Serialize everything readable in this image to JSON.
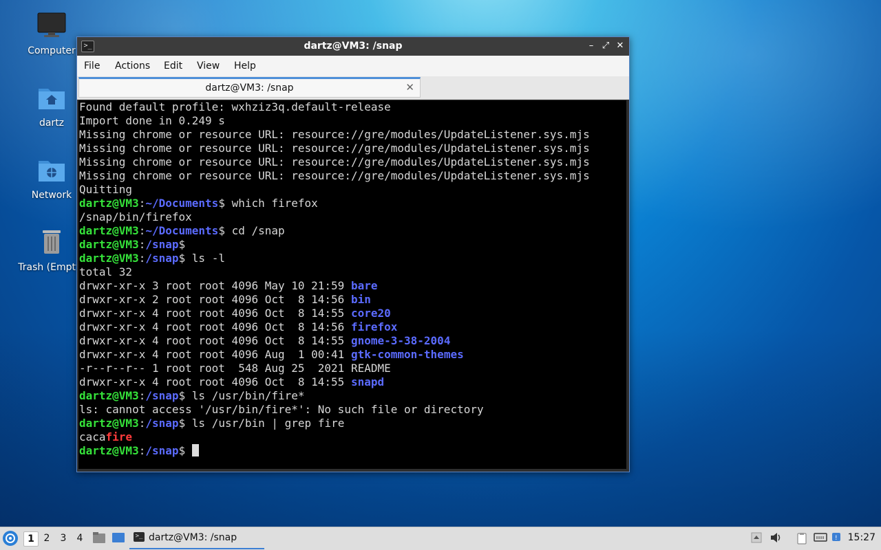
{
  "desktop": {
    "icons": [
      {
        "label": "Computer"
      },
      {
        "label": "dartz"
      },
      {
        "label": "Network"
      },
      {
        "label": "Trash (Empty)"
      }
    ]
  },
  "window": {
    "title": "dartz@VM3: /snap",
    "controls": {
      "minimize": "–",
      "maximize": "⤢",
      "close": "✕"
    },
    "menu": [
      "File",
      "Actions",
      "Edit",
      "View",
      "Help"
    ],
    "tab": {
      "label": "dartz@VM3: /snap",
      "close": "✕"
    }
  },
  "terminal": {
    "lines": [
      "Found default profile: wxhziz3q.default-release",
      "Import done in 0.249 s",
      "Missing chrome or resource URL: resource://gre/modules/UpdateListener.sys.mjs",
      "Missing chrome or resource URL: resource://gre/modules/UpdateListener.sys.mjs",
      "Missing chrome or resource URL: resource://gre/modules/UpdateListener.sys.mjs",
      "Missing chrome or resource URL: resource://gre/modules/UpdateListener.sys.mjs",
      "Quitting",
      "/snap/bin/firefox",
      "total 32",
      "ls: cannot access '/usr/bin/fire*': No such file or directory",
      "caca"
    ],
    "prompt_user": "dartz@VM3",
    "colon": ":",
    "dollar": "$",
    "path_documents": "~/Documents",
    "path_snap": "/snap",
    "cmd_which": " which firefox",
    "cmd_cd": " cd /snap",
    "cmd_ls_l": " ls -l",
    "cmd_ls_fire": " ls /usr/bin/fire*",
    "cmd_grep": " ls /usr/bin | grep fire",
    "grep_match": "fire",
    "prompt_trailing": " ",
    "listing": [
      {
        "meta": "drwxr-xr-x 3 root root 4096 May 10 21:59 ",
        "name": "bare",
        "is_dir": true
      },
      {
        "meta": "drwxr-xr-x 2 root root 4096 Oct  8 14:56 ",
        "name": "bin",
        "is_dir": true
      },
      {
        "meta": "drwxr-xr-x 4 root root 4096 Oct  8 14:55 ",
        "name": "core20",
        "is_dir": true
      },
      {
        "meta": "drwxr-xr-x 4 root root 4096 Oct  8 14:56 ",
        "name": "firefox",
        "is_dir": true
      },
      {
        "meta": "drwxr-xr-x 4 root root 4096 Oct  8 14:55 ",
        "name": "gnome-3-38-2004",
        "is_dir": true
      },
      {
        "meta": "drwxr-xr-x 4 root root 4096 Aug  1 00:41 ",
        "name": "gtk-common-themes",
        "is_dir": true
      },
      {
        "meta": "-r--r--r-- 1 root root  548 Aug 25  2021 ",
        "name": "README",
        "is_dir": false
      },
      {
        "meta": "drwxr-xr-x 4 root root 4096 Oct  8 14:55 ",
        "name": "snapd",
        "is_dir": true
      }
    ]
  },
  "taskbar": {
    "workspaces": [
      "1",
      "2",
      "3",
      "4"
    ],
    "task_label": "dartz@VM3: /snap",
    "clock": "15:27"
  },
  "colors": {
    "prompt_user": "#35e23a",
    "prompt_path": "#5b6bff",
    "grep_highlight": "#ff3b3b",
    "accent": "#3b7fd4"
  }
}
